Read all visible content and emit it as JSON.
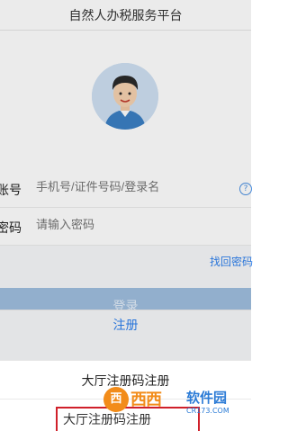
{
  "header": {
    "title": "自然人办税服务平台"
  },
  "profile": {
    "avatar_icon": "user-avatar-icon"
  },
  "form": {
    "account_label": "账号",
    "account_placeholder": "手机号/证件号码/登录名",
    "password_label": "密码",
    "password_placeholder": "请输入密码",
    "help_icon": "question-circle-icon",
    "forgot_link": "找回密码"
  },
  "actions": {
    "login_label": "登录",
    "register_label": "注册"
  },
  "sheet": {
    "title": "大厅注册码注册",
    "option_label": "大厅注册码注册"
  },
  "watermark": {
    "badge": "西",
    "brand": "西西",
    "sub": "软件园",
    "url": "CR173.COM"
  },
  "colors": {
    "accent": "#2f80ed",
    "button_disabled": "#9fbedf",
    "highlight": "#d0202a",
    "watermark": "#f28c1a"
  }
}
